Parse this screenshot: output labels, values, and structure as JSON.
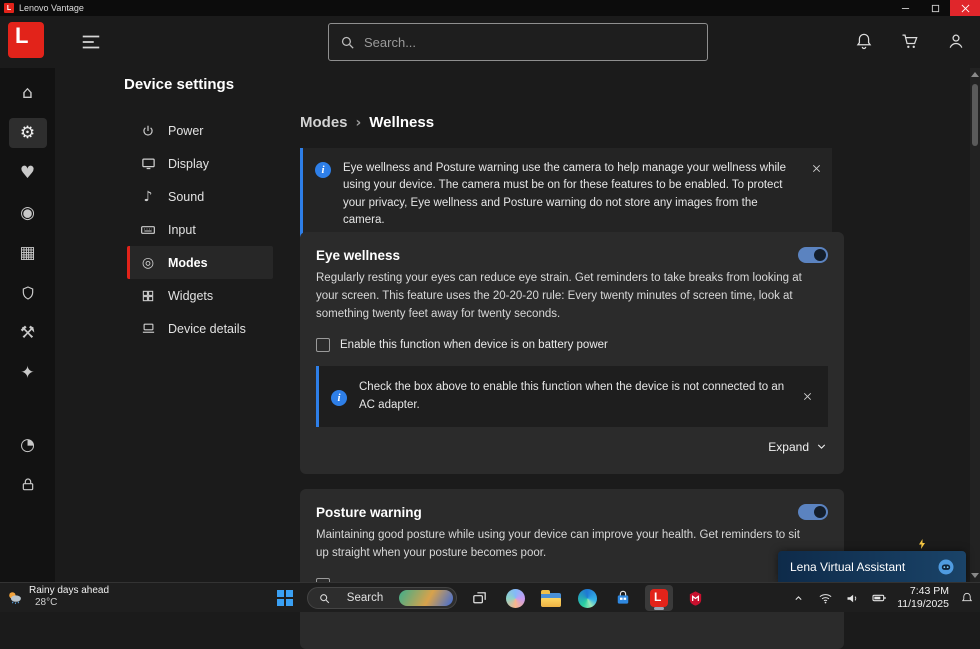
{
  "window": {
    "title": "Lenovo Vantage",
    "logo_letter": "L"
  },
  "header": {
    "search_placeholder": "Search..."
  },
  "icons": {
    "home": "⌂",
    "gear": "⚙",
    "health": "♥",
    "power_status": "◉",
    "apps": "▦",
    "tools": "⚒",
    "smart": "✦",
    "gauge": "◔",
    "sound": "♪",
    "modes": "◎",
    "breadcrumb_sep": "›",
    "info": "i"
  },
  "sidebar": {
    "title": "Device settings",
    "items": [
      {
        "label": "Power"
      },
      {
        "label": "Display"
      },
      {
        "label": "Sound"
      },
      {
        "label": "Input"
      },
      {
        "label": "Modes",
        "selected": true
      },
      {
        "label": "Widgets"
      },
      {
        "label": "Device details"
      }
    ]
  },
  "breadcrumb": {
    "parent": "Modes",
    "current": "Wellness"
  },
  "camera_banner": {
    "text": "Eye wellness and Posture warning use the camera to help manage your wellness while using your device. The camera must be on for these features to be enabled. To protect your privacy, Eye wellness and Posture warning do not store any images from the camera."
  },
  "eye_wellness": {
    "title": "Eye wellness",
    "toggle_state": "on",
    "description": "Regularly resting your eyes can reduce eye strain. Get reminders to take breaks from looking at your screen. This feature uses the 20-20-20 rule: Every twenty minutes of screen time, look at something twenty feet away for twenty seconds.",
    "battery_checkbox_label": "Enable this function when device is on battery power",
    "battery_checkbox_checked": false,
    "ac_banner_text": "Check the box above to enable this function when the device is not connected to an AC adapter.",
    "expand_label": "Expand"
  },
  "posture_warning": {
    "title": "Posture warning",
    "toggle_state": "on",
    "description": "Maintaining good posture while using your device can improve your health. Get reminders to sit up straight when your posture becomes poor."
  },
  "lena": {
    "label": "Lena Virtual Assistant"
  },
  "taskbar": {
    "weather_title": "Rainy days ahead",
    "weather_temp": "28°C",
    "search_label": "Search",
    "clock_time": "7:43 PM",
    "clock_date": "11/19/2025",
    "vantage_letter": "L"
  },
  "colors": {
    "accent_red": "#e2231a",
    "info_blue": "#2e7fe8",
    "toggle_blue": "#5b83c0"
  }
}
